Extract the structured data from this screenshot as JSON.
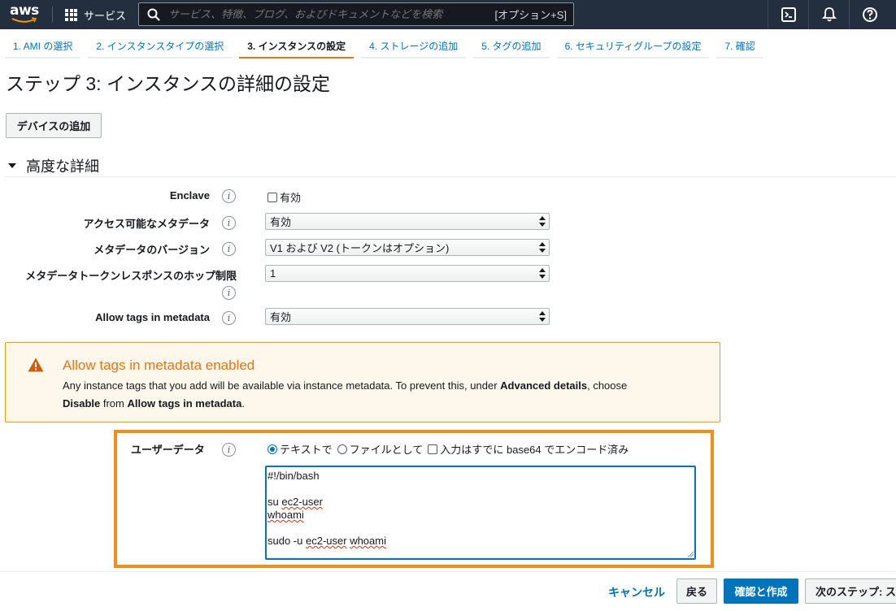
{
  "topnav": {
    "logo": "aws",
    "services_label": "サービス",
    "search_placeholder": "サービス、特徴、ブログ、およびドキュメントなどを検索",
    "search_shortcut": "[オプション+S]"
  },
  "tabs": [
    {
      "label": "1. AMI の選択"
    },
    {
      "label": "2. インスタンスタイプの選択"
    },
    {
      "label": "3. インスタンスの設定",
      "active": true
    },
    {
      "label": "4. ストレージの追加"
    },
    {
      "label": "5. タグの追加"
    },
    {
      "label": "6. セキュリティグループの設定"
    },
    {
      "label": "7. 確認"
    }
  ],
  "page_title": "ステップ 3: インスタンスの詳細の設定",
  "device_button": "デバイスの追加",
  "advanced": {
    "heading": "高度な詳細",
    "enclave": {
      "label": "Enclave",
      "checkbox_label": "有効"
    },
    "metadata_accessible": {
      "label": "アクセス可能なメタデータ",
      "value": "有効"
    },
    "metadata_version": {
      "label": "メタデータのバージョン",
      "value": "V1 および V2 (トークンはオプション)"
    },
    "hop_limit": {
      "label": "メタデータトークンレスポンスのホップ制限",
      "value": "1"
    },
    "allow_tags": {
      "label": "Allow tags in metadata",
      "value": "有効"
    }
  },
  "alert": {
    "title": "Allow tags in metadata enabled",
    "body_1": "Any instance tags that you add will be available via instance metadata. To prevent this, under ",
    "bold_1": "Advanced details",
    "body_2": ", choose",
    "bold_2": "Disable",
    "body_3": " from ",
    "bold_3": "Allow tags in metadata",
    "body_4": "."
  },
  "user_data": {
    "label": "ユーザーデータ",
    "option_text": "テキストで",
    "option_file": "ファイルとして",
    "option_base64": "入力はすでに base64 でエンコード済み",
    "line1": "#!/bin/bash",
    "line2": "",
    "line3a": "su ",
    "line3b": "ec2-user",
    "line4": "whoami",
    "line5": "",
    "line6a": "sudo -u ",
    "line6b": "ec2-user",
    "line6c": " ",
    "line6d": "whoami"
  },
  "footer": {
    "cancel": "キャンセル",
    "back": "戻る",
    "review_launch": "確認と作成",
    "next": "次のステップ: ストレージの追加"
  },
  "colors": {
    "nav_bg": "#232f3e",
    "link": "#0073bb",
    "accent": "#ec7211",
    "warning_bg": "#fef8ec"
  }
}
